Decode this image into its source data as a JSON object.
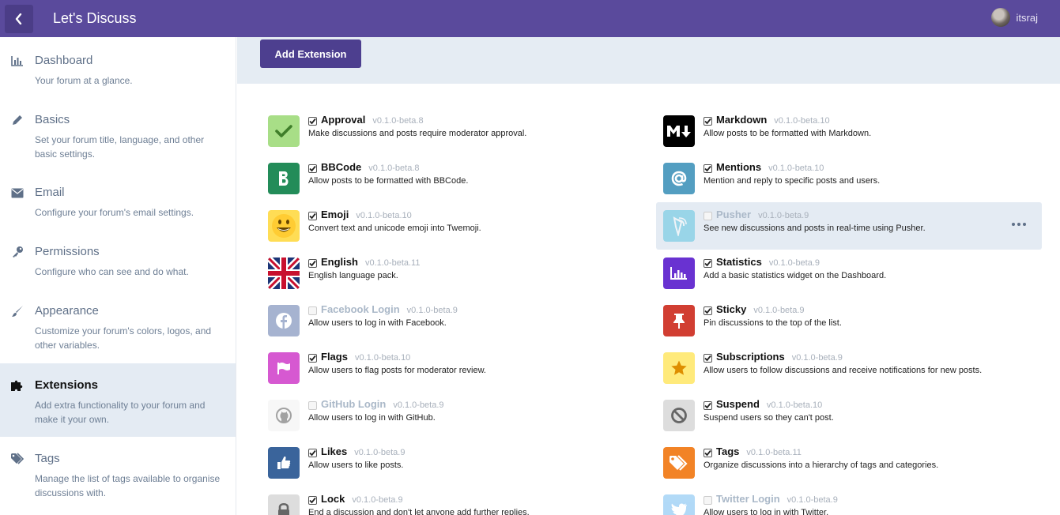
{
  "header": {
    "title": "Let's Discuss",
    "username": "itsraj"
  },
  "sidebar": {
    "items": [
      {
        "key": "dashboard",
        "label": "Dashboard",
        "description": "Your forum at a glance.",
        "icon": "bar-chart-icon",
        "active": false
      },
      {
        "key": "basics",
        "label": "Basics",
        "description": "Set your forum title, language, and other basic settings.",
        "icon": "pencil-icon",
        "active": false
      },
      {
        "key": "email",
        "label": "Email",
        "description": "Configure your forum's email settings.",
        "icon": "envelope-icon",
        "active": false
      },
      {
        "key": "permissions",
        "label": "Permissions",
        "description": "Configure who can see and do what.",
        "icon": "key-icon",
        "active": false
      },
      {
        "key": "appearance",
        "label": "Appearance",
        "description": "Customize your forum's colors, logos, and other variables.",
        "icon": "paintbrush-icon",
        "active": false
      },
      {
        "key": "extensions",
        "label": "Extensions",
        "description": "Add extra functionality to your forum and make it your own.",
        "icon": "puzzle-icon",
        "active": true
      },
      {
        "key": "tags",
        "label": "Tags",
        "description": "Manage the list of tags available to organise discussions with.",
        "icon": "tags-icon",
        "active": false
      }
    ]
  },
  "toolbar": {
    "add_label": "Add Extension"
  },
  "extensions": {
    "left": [
      {
        "name": "Approval",
        "version": "v0.1.0-beta.8",
        "description": "Make discussions and posts require moderator approval.",
        "enabled": true,
        "icon": "check-icon",
        "bg": "#a8de87",
        "fg": "#3f7e2a"
      },
      {
        "name": "BBCode",
        "version": "v0.1.0-beta.8",
        "description": "Allow posts to be formatted with BBCode.",
        "enabled": true,
        "icon": "bold-b-icon",
        "bg": "#238c59",
        "fg": "#ffffff"
      },
      {
        "name": "Emoji",
        "version": "v0.1.0-beta.10",
        "description": "Convert text and unicode emoji into Twemoji.",
        "enabled": true,
        "icon": "smiley-icon",
        "bg": "#ffdd55",
        "fg": "#333333"
      },
      {
        "name": "English",
        "version": "v0.1.0-beta.11",
        "description": "English language pack.",
        "enabled": true,
        "icon": "union-jack-flag-icon",
        "bg": "#1b3476",
        "fg": "#c8102e"
      },
      {
        "name": "Facebook Login",
        "version": "v0.1.0-beta.9",
        "description": "Allow users to log in with Facebook.",
        "enabled": false,
        "icon": "facebook-icon",
        "bg": "#3b5998",
        "fg": "#ffffff"
      },
      {
        "name": "Flags",
        "version": "v0.1.0-beta.10",
        "description": "Allow users to flag posts for moderator review.",
        "enabled": true,
        "icon": "flag-icon",
        "bg": "#d659d1",
        "fg": "#ffffff"
      },
      {
        "name": "GitHub Login",
        "version": "v0.1.0-beta.9",
        "description": "Allow users to log in with GitHub.",
        "enabled": false,
        "icon": "github-icon",
        "bg": "#eeeeee",
        "fg": "#333333"
      },
      {
        "name": "Likes",
        "version": "v0.1.0-beta.9",
        "description": "Allow users to like posts.",
        "enabled": true,
        "icon": "thumbs-up-icon",
        "bg": "#3a649b",
        "fg": "#ffffff"
      },
      {
        "name": "Lock",
        "version": "v0.1.0-beta.9",
        "description": "End a discussion and don't let anyone add further replies.",
        "enabled": true,
        "icon": "lock-icon",
        "bg": "#dddddd",
        "fg": "#666666"
      }
    ],
    "right": [
      {
        "name": "Markdown",
        "version": "v0.1.0-beta.10",
        "description": "Allow posts to be formatted with Markdown.",
        "enabled": true,
        "icon": "markdown-icon",
        "bg": "#000000",
        "fg": "#ffffff"
      },
      {
        "name": "Mentions",
        "version": "v0.1.0-beta.10",
        "description": "Mention and reply to specific posts and users.",
        "enabled": true,
        "icon": "at-sign-icon",
        "bg": "#539ec1",
        "fg": "#ffffff"
      },
      {
        "name": "Pusher",
        "version": "v0.1.0-beta.9",
        "description": "See new discussions and posts in real-time using Pusher.",
        "enabled": false,
        "icon": "pusher-icon",
        "bg": "#40bbdb",
        "fg": "#ffffff",
        "hover": true
      },
      {
        "name": "Statistics",
        "version": "v0.1.0-beta.9",
        "description": "Add a basic statistics widget on the Dashboard.",
        "enabled": true,
        "icon": "bar-chart-icon",
        "bg": "#6932d1",
        "fg": "#ffffff"
      },
      {
        "name": "Sticky",
        "version": "v0.1.0-beta.9",
        "description": "Pin discussions to the top of the list.",
        "enabled": true,
        "icon": "pin-icon",
        "bg": "#d13e32",
        "fg": "#ffffff"
      },
      {
        "name": "Subscriptions",
        "version": "v0.1.0-beta.9",
        "description": "Allow users to follow discussions and receive notifications for new posts.",
        "enabled": true,
        "icon": "star-icon",
        "bg": "#ffea7b",
        "fg": "#de8e00"
      },
      {
        "name": "Suspend",
        "version": "v0.1.0-beta.10",
        "description": "Suspend users so they can't post.",
        "enabled": true,
        "icon": "ban-icon",
        "bg": "#dddddd",
        "fg": "#666666"
      },
      {
        "name": "Tags",
        "version": "v0.1.0-beta.11",
        "description": "Organize discussions into a hierarchy of tags and categories.",
        "enabled": true,
        "icon": "tags-icon",
        "bg": "#f28326",
        "fg": "#ffffff"
      },
      {
        "name": "Twitter Login",
        "version": "v0.1.0-beta.9",
        "description": "Allow users to log in with Twitter.",
        "enabled": false,
        "icon": "twitter-icon",
        "bg": "#55adee",
        "fg": "#ffffff"
      }
    ]
  }
}
